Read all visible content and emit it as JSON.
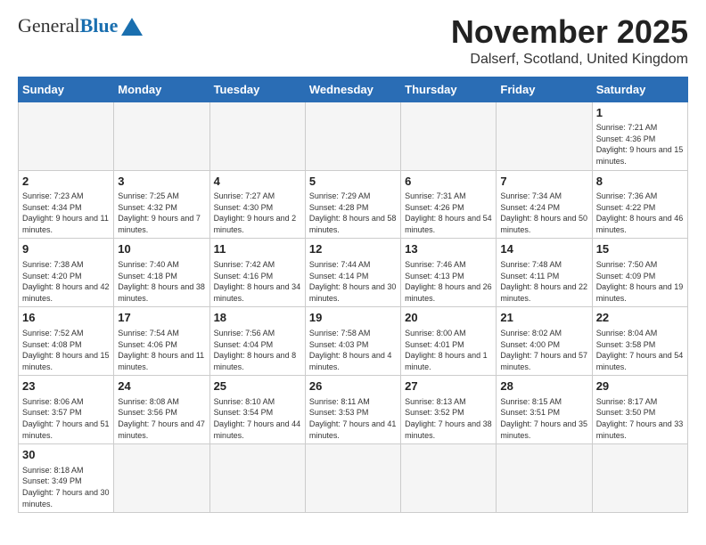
{
  "header": {
    "logo_general": "General",
    "logo_blue": "Blue",
    "month_title": "November 2025",
    "location": "Dalserf, Scotland, United Kingdom"
  },
  "weekdays": [
    "Sunday",
    "Monday",
    "Tuesday",
    "Wednesday",
    "Thursday",
    "Friday",
    "Saturday"
  ],
  "weeks": [
    [
      {
        "day": null,
        "info": ""
      },
      {
        "day": null,
        "info": ""
      },
      {
        "day": null,
        "info": ""
      },
      {
        "day": null,
        "info": ""
      },
      {
        "day": null,
        "info": ""
      },
      {
        "day": null,
        "info": ""
      },
      {
        "day": "1",
        "info": "Sunrise: 7:21 AM\nSunset: 4:36 PM\nDaylight: 9 hours and 15 minutes."
      }
    ],
    [
      {
        "day": "2",
        "info": "Sunrise: 7:23 AM\nSunset: 4:34 PM\nDaylight: 9 hours and 11 minutes."
      },
      {
        "day": "3",
        "info": "Sunrise: 7:25 AM\nSunset: 4:32 PM\nDaylight: 9 hours and 7 minutes."
      },
      {
        "day": "4",
        "info": "Sunrise: 7:27 AM\nSunset: 4:30 PM\nDaylight: 9 hours and 2 minutes."
      },
      {
        "day": "5",
        "info": "Sunrise: 7:29 AM\nSunset: 4:28 PM\nDaylight: 8 hours and 58 minutes."
      },
      {
        "day": "6",
        "info": "Sunrise: 7:31 AM\nSunset: 4:26 PM\nDaylight: 8 hours and 54 minutes."
      },
      {
        "day": "7",
        "info": "Sunrise: 7:34 AM\nSunset: 4:24 PM\nDaylight: 8 hours and 50 minutes."
      },
      {
        "day": "8",
        "info": "Sunrise: 7:36 AM\nSunset: 4:22 PM\nDaylight: 8 hours and 46 minutes."
      }
    ],
    [
      {
        "day": "9",
        "info": "Sunrise: 7:38 AM\nSunset: 4:20 PM\nDaylight: 8 hours and 42 minutes."
      },
      {
        "day": "10",
        "info": "Sunrise: 7:40 AM\nSunset: 4:18 PM\nDaylight: 8 hours and 38 minutes."
      },
      {
        "day": "11",
        "info": "Sunrise: 7:42 AM\nSunset: 4:16 PM\nDaylight: 8 hours and 34 minutes."
      },
      {
        "day": "12",
        "info": "Sunrise: 7:44 AM\nSunset: 4:14 PM\nDaylight: 8 hours and 30 minutes."
      },
      {
        "day": "13",
        "info": "Sunrise: 7:46 AM\nSunset: 4:13 PM\nDaylight: 8 hours and 26 minutes."
      },
      {
        "day": "14",
        "info": "Sunrise: 7:48 AM\nSunset: 4:11 PM\nDaylight: 8 hours and 22 minutes."
      },
      {
        "day": "15",
        "info": "Sunrise: 7:50 AM\nSunset: 4:09 PM\nDaylight: 8 hours and 19 minutes."
      }
    ],
    [
      {
        "day": "16",
        "info": "Sunrise: 7:52 AM\nSunset: 4:08 PM\nDaylight: 8 hours and 15 minutes."
      },
      {
        "day": "17",
        "info": "Sunrise: 7:54 AM\nSunset: 4:06 PM\nDaylight: 8 hours and 11 minutes."
      },
      {
        "day": "18",
        "info": "Sunrise: 7:56 AM\nSunset: 4:04 PM\nDaylight: 8 hours and 8 minutes."
      },
      {
        "day": "19",
        "info": "Sunrise: 7:58 AM\nSunset: 4:03 PM\nDaylight: 8 hours and 4 minutes."
      },
      {
        "day": "20",
        "info": "Sunrise: 8:00 AM\nSunset: 4:01 PM\nDaylight: 8 hours and 1 minute."
      },
      {
        "day": "21",
        "info": "Sunrise: 8:02 AM\nSunset: 4:00 PM\nDaylight: 7 hours and 57 minutes."
      },
      {
        "day": "22",
        "info": "Sunrise: 8:04 AM\nSunset: 3:58 PM\nDaylight: 7 hours and 54 minutes."
      }
    ],
    [
      {
        "day": "23",
        "info": "Sunrise: 8:06 AM\nSunset: 3:57 PM\nDaylight: 7 hours and 51 minutes."
      },
      {
        "day": "24",
        "info": "Sunrise: 8:08 AM\nSunset: 3:56 PM\nDaylight: 7 hours and 47 minutes."
      },
      {
        "day": "25",
        "info": "Sunrise: 8:10 AM\nSunset: 3:54 PM\nDaylight: 7 hours and 44 minutes."
      },
      {
        "day": "26",
        "info": "Sunrise: 8:11 AM\nSunset: 3:53 PM\nDaylight: 7 hours and 41 minutes."
      },
      {
        "day": "27",
        "info": "Sunrise: 8:13 AM\nSunset: 3:52 PM\nDaylight: 7 hours and 38 minutes."
      },
      {
        "day": "28",
        "info": "Sunrise: 8:15 AM\nSunset: 3:51 PM\nDaylight: 7 hours and 35 minutes."
      },
      {
        "day": "29",
        "info": "Sunrise: 8:17 AM\nSunset: 3:50 PM\nDaylight: 7 hours and 33 minutes."
      }
    ],
    [
      {
        "day": "30",
        "info": "Sunrise: 8:18 AM\nSunset: 3:49 PM\nDaylight: 7 hours and 30 minutes."
      },
      {
        "day": null,
        "info": ""
      },
      {
        "day": null,
        "info": ""
      },
      {
        "day": null,
        "info": ""
      },
      {
        "day": null,
        "info": ""
      },
      {
        "day": null,
        "info": ""
      },
      {
        "day": null,
        "info": ""
      }
    ]
  ]
}
